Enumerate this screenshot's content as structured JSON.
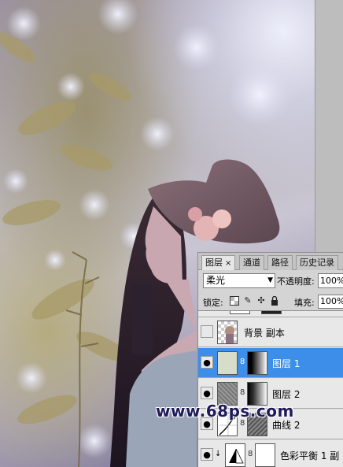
{
  "panel": {
    "tabs": [
      {
        "label": "图层",
        "active": true
      },
      {
        "label": "通道",
        "active": false
      },
      {
        "label": "路径",
        "active": false
      },
      {
        "label": "历史记录",
        "active": false
      }
    ],
    "close_glyph": "×",
    "blend_mode": "柔光",
    "opacity_label": "不透明度:",
    "opacity_value": "100%",
    "lock_label": "锁定:",
    "lock_icons": [
      "transparent-pixels-lock-icon",
      "image-pixels-lock-icon",
      "position-lock-icon",
      "all-lock-icon"
    ],
    "fill_label": "填充:",
    "fill_value": "100%",
    "layers": [
      {
        "name": "背景 副本",
        "visible": false,
        "selected": false
      },
      {
        "name": "图层 1",
        "visible": true,
        "selected": true
      },
      {
        "name": "图层 2",
        "visible": true,
        "selected": false
      },
      {
        "name": "曲线 2",
        "visible": true,
        "selected": false
      },
      {
        "name": "色彩平衡 1 副",
        "visible": true,
        "selected": false
      }
    ]
  },
  "watermark": "www.68ps.com",
  "colors": {
    "selected_layer": "#3d8ee8",
    "panel_bg": "#d4d4d4",
    "watermark": "#1f1b5a"
  }
}
